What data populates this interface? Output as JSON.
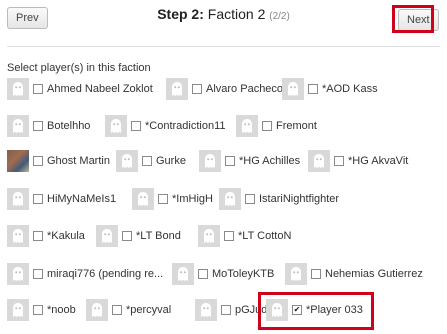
{
  "header": {
    "prev_label": "Prev",
    "next_label": "Next",
    "title_step": "Step 2:",
    "title_faction": "Faction 2",
    "title_count": "(2/2)"
  },
  "instruction": "Select player(s) in this faction",
  "players": [
    {
      "name": "Ahmed Nabeel Zoklot",
      "checked": false,
      "avatar": "default-avatar-icon"
    },
    {
      "name": "Alvaro Pacheco",
      "checked": false,
      "avatar": "default-avatar-icon"
    },
    {
      "name": "*AOD Kass",
      "checked": false,
      "avatar": "default-avatar-icon"
    },
    {
      "name": "Botelhho",
      "checked": false,
      "avatar": "default-avatar-icon"
    },
    {
      "name": "*Contradiction11",
      "checked": false,
      "avatar": "default-avatar-icon"
    },
    {
      "name": "Fremont",
      "checked": false,
      "avatar": "default-avatar-icon"
    },
    {
      "name": "Ghost Martin",
      "checked": false,
      "avatar": "photo-avatar"
    },
    {
      "name": "Gurke",
      "checked": false,
      "avatar": "default-avatar-icon"
    },
    {
      "name": "*HG Achilles",
      "checked": false,
      "avatar": "default-avatar-icon"
    },
    {
      "name": "*HG AkvaVit",
      "checked": false,
      "avatar": "default-avatar-icon"
    },
    {
      "name": "HiMyNaMeIs1",
      "checked": false,
      "avatar": "default-avatar-icon"
    },
    {
      "name": "*ImHigH",
      "checked": false,
      "avatar": "default-avatar-icon"
    },
    {
      "name": "IstariNightfighter",
      "checked": false,
      "avatar": "default-avatar-icon"
    },
    {
      "name": "*Kakula",
      "checked": false,
      "avatar": "default-avatar-icon"
    },
    {
      "name": "*LT Bond",
      "checked": false,
      "avatar": "default-avatar-icon"
    },
    {
      "name": "*LT CottoN",
      "checked": false,
      "avatar": "default-avatar-icon"
    },
    {
      "name": "miraqi776 (pending re...",
      "checked": false,
      "avatar": "default-avatar-icon"
    },
    {
      "name": "MoToleyKTB",
      "checked": false,
      "avatar": "default-avatar-icon"
    },
    {
      "name": "Nehemias Gutierrez",
      "checked": false,
      "avatar": "default-avatar-icon"
    },
    {
      "name": "*noob",
      "checked": false,
      "avatar": "default-avatar-icon"
    },
    {
      "name": "*percyval",
      "checked": false,
      "avatar": "default-avatar-icon"
    },
    {
      "name": "pGJude",
      "checked": false,
      "avatar": "default-avatar-icon"
    },
    {
      "name": "*Player 033",
      "checked": true,
      "avatar": "default-avatar-icon"
    }
  ],
  "colors": {
    "highlight": "#d0021b",
    "avatar_bg": "#d9d9d9"
  }
}
